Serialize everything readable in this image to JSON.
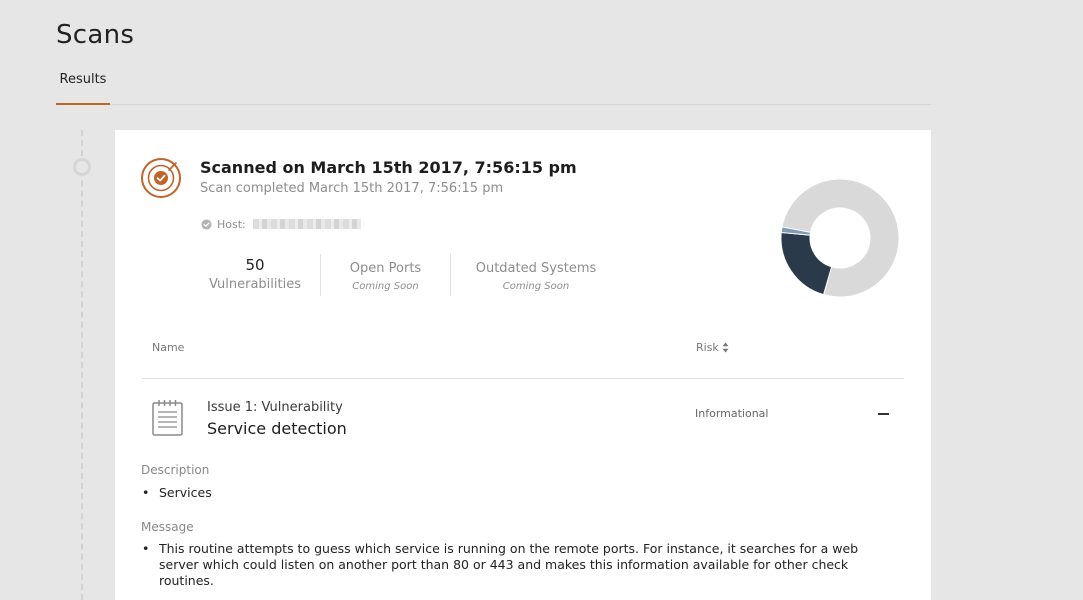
{
  "page": {
    "title": "Scans"
  },
  "tabs": [
    {
      "label": "Results",
      "active": true
    }
  ],
  "scan": {
    "title": "Scanned on March 15th 2017, 7:56:15 pm",
    "subtitle": "Scan completed March 15th 2017, 7:56:15 pm",
    "host_label": "Host:",
    "icon": "radar-target-icon",
    "host_icon": "check-circle-icon"
  },
  "stats": {
    "vulnerabilities": {
      "value": "50",
      "label": "Vulnerabilities"
    },
    "open_ports": {
      "label": "Open Ports",
      "note": "Coming Soon"
    },
    "outdated_systems": {
      "label": "Outdated Systems",
      "note": "Coming Soon"
    }
  },
  "donut": {
    "segments": [
      {
        "name": "informational",
        "fraction": 0.765,
        "color": "#d9d9d9"
      },
      {
        "name": "segment-dark",
        "fraction": 0.22,
        "color": "#2b3a4a"
      },
      {
        "name": "segment-light",
        "fraction": 0.015,
        "color": "#7f9bb5"
      }
    ]
  },
  "table": {
    "columns": {
      "name": "Name",
      "risk": "Risk"
    },
    "sort_icon": "sort-icon"
  },
  "issue": {
    "label": "Issue 1: Vulnerability",
    "title": "Service detection",
    "risk": "Informational",
    "icon": "notepad-icon",
    "collapse_icon": "minus-icon",
    "description_label": "Description",
    "description_items": [
      "Services"
    ],
    "message_label": "Message",
    "message_items": [
      "This routine attempts to guess which service is running on the remote ports. For instance, it searches for a web server which could listen on another port than 80 or 443 and makes this information available for other check routines."
    ]
  },
  "colors": {
    "accent": "#c0642a",
    "background": "#e6e6e6",
    "card": "#ffffff",
    "muted_text": "#8d8d8d"
  }
}
